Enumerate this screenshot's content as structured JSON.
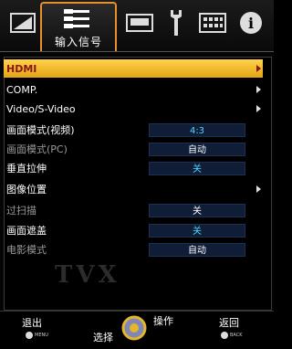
{
  "tabs": [
    {
      "name": "picture-icon"
    },
    {
      "name": "input-signal-icon",
      "label": "输入信号"
    },
    {
      "name": "screen-icon"
    },
    {
      "name": "setup-wrench-icon"
    },
    {
      "name": "keyboard-icon"
    },
    {
      "name": "info-icon",
      "label": "i"
    }
  ],
  "menu": [
    {
      "label": "HDMI",
      "arrow": true,
      "selected": true
    },
    {
      "label": "COMP.",
      "arrow": true
    },
    {
      "label": "Video/S-Video",
      "arrow": true
    },
    {
      "label": "画面模式(视频)",
      "value": "4:3",
      "valueColor": "cyan"
    },
    {
      "label": "画面模式(PC)",
      "value": "自动",
      "dim": true
    },
    {
      "label": "垂直拉伸",
      "value": "关",
      "valueColor": "cyan"
    },
    {
      "label": "图像位置",
      "arrow": true
    },
    {
      "label": "过扫描",
      "value": "关",
      "dim": true
    },
    {
      "label": "画面遮盖",
      "value": "关",
      "valueColor": "cyan"
    },
    {
      "label": "电影模式",
      "value": "自动",
      "dim": true
    }
  ],
  "logo": "TVX",
  "footer": {
    "exit_label": "退出",
    "menu_button": "MENU",
    "select_label": "选择",
    "operate_label": "操作",
    "back_label": "返回",
    "back_button": "BACK"
  }
}
